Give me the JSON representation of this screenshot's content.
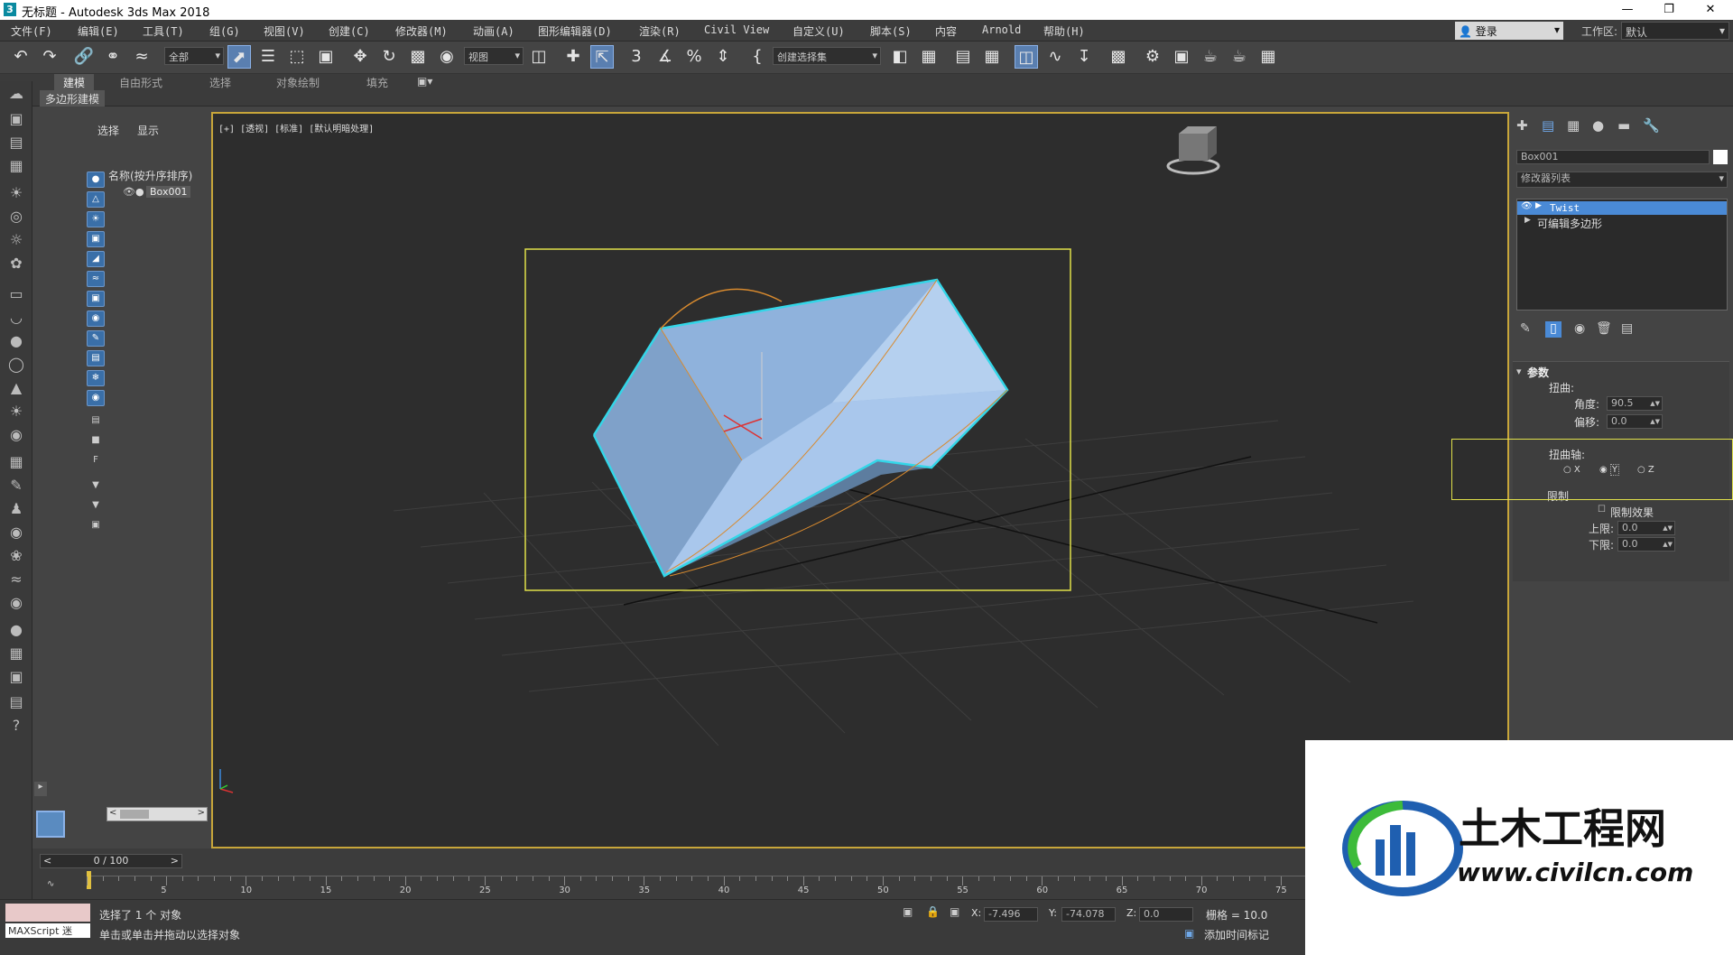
{
  "window": {
    "title": "无标题 - Autodesk 3ds Max 2018"
  },
  "menu": [
    "文件(F)",
    "编辑(E)",
    "工具(T)",
    "组(G)",
    "视图(V)",
    "创建(C)",
    "修改器(M)",
    "动画(A)",
    "图形编辑器(D)",
    "渲染(R)",
    "Civil View",
    "自定义(U)",
    "脚本(S)",
    "内容",
    "Arnold",
    "帮助(H)"
  ],
  "account": {
    "login": "登录",
    "workspace_label": "工作区:",
    "workspace_value": "默认"
  },
  "toolbar": {
    "selection_filter": "全部",
    "ref_coord": "视图",
    "named_selection": "创建选择集"
  },
  "ribbon": {
    "tabs": [
      "建模",
      "自由形式",
      "选择",
      "对象绘制",
      "填充"
    ],
    "sub_label": "多边形建模"
  },
  "scene_explorer": {
    "tab_select": "选择",
    "tab_display": "显示",
    "column_header": "名称(按升序排序)",
    "objects": [
      "Box001"
    ]
  },
  "viewport": {
    "label": "[+] [透视] [标准] [默认明暗处理]",
    "colors": {
      "bbox": "#e0e04a",
      "selection_outline": "#33d6e8",
      "gizmo": "#d88a2e",
      "mesh": "#9dbde6",
      "frame": "#c8a63a"
    }
  },
  "command_panel": {
    "object_name": "Box001",
    "modifier_list": "修改器列表",
    "stack": [
      "Twist",
      "可编辑多边形"
    ],
    "params_title": "参数",
    "twist_label": "扭曲:",
    "angle_label": "角度:",
    "angle_value": "90.5",
    "bias_label": "偏移:",
    "bias_value": "0.0",
    "axis_label": "扭曲轴:",
    "axis_x": "X",
    "axis_y": "Y",
    "axis_z": "Z",
    "axis_selected": "Y",
    "limits_label": "限制",
    "limit_effect": "限制效果",
    "upper_label": "上限:",
    "upper_value": "0.0",
    "lower_label": "下限:",
    "lower_value": "0.0"
  },
  "timeline": {
    "frame": "0 / 100",
    "ticks": [
      "5",
      "10",
      "15",
      "20",
      "25",
      "30",
      "35",
      "40",
      "45",
      "50",
      "55",
      "60",
      "65",
      "70",
      "75"
    ]
  },
  "status": {
    "maxscript": "MAXScript 迷",
    "selected": "选择了 1 个 对象",
    "hint": "单击或单击并拖动以选择对象",
    "x_label": "X:",
    "x_value": "-7.496",
    "y_label": "Y:",
    "y_value": "-74.078",
    "z_label": "Z:",
    "z_value": "0.0",
    "grid": "栅格 = 10.0",
    "add_time_tag": "添加时间标记"
  },
  "watermark": {
    "brand": "土木工程网",
    "url": "www.civilcn.com"
  }
}
